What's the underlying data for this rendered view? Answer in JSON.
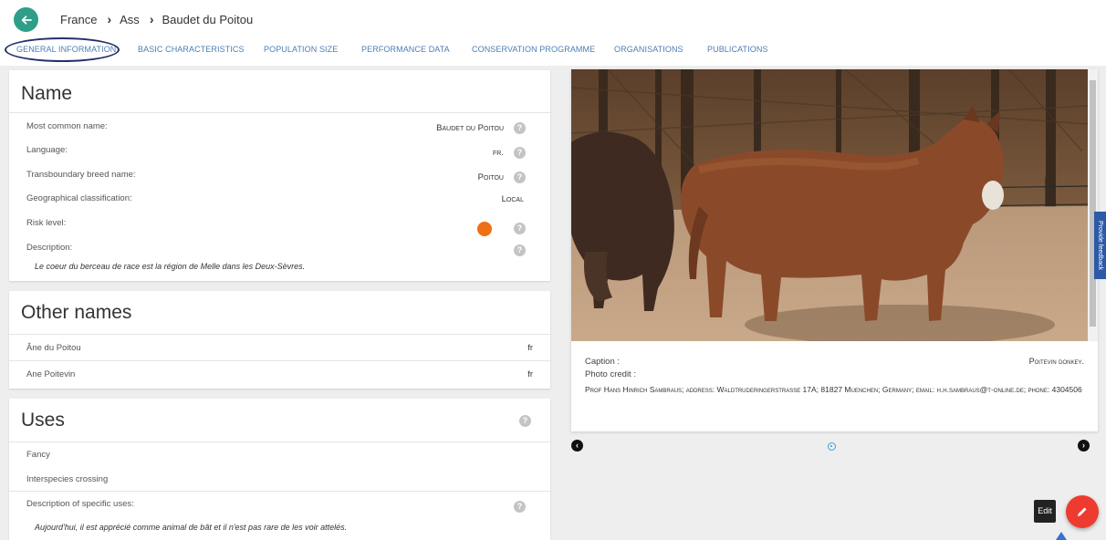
{
  "header": {
    "breadcrumb": [
      "France",
      "Ass",
      "Baudet du Poitou"
    ],
    "tabs": [
      "GENERAL INFORMATION",
      "BASIC CHARACTERISTICS",
      "POPULATION SIZE",
      "PERFORMANCE DATA",
      "CONSERVATION PROGRAMME",
      "ORGANISATIONS",
      "PUBLICATIONS"
    ]
  },
  "name_section": {
    "title": "Name",
    "rows": [
      {
        "label": "Most common name:",
        "value": "Baudet du Poitou"
      },
      {
        "label": "Language:",
        "value": "fr."
      },
      {
        "label": "Transboundary breed name:",
        "value": "Poitou"
      },
      {
        "label": "Geographical classification:",
        "value": "Local"
      },
      {
        "label": "Risk level:",
        "value": ""
      },
      {
        "label": "Description:",
        "value": ""
      }
    ],
    "description": "Le coeur du berceau de race est la région de Melle dans les Deux-Sèvres.",
    "risk_color": "#ee6f16"
  },
  "other_names": {
    "title": "Other names",
    "items": [
      {
        "name": "Âne du Poitou",
        "lang": "fr"
      },
      {
        "name": "Ane Poitevin",
        "lang": "fr"
      }
    ]
  },
  "uses": {
    "title": "Uses",
    "items": [
      "Fancy",
      "Interspecies crossing"
    ],
    "specific_label": "Description of specific uses:",
    "specific_text": "Aujourd'hui, il est apprécié comme animal de bât et il n'est pas rare de les voir attelés."
  },
  "photo": {
    "caption_label": "Caption :",
    "caption_value": "Poitevin donkey.",
    "credit_label": "Photo credit :",
    "credit_text": "Prof Hans Hinrich Sambraus; address: Waldtruderingerstrasse 17A; 81827 Muenchen; Germany; email: h.h.sambraus@t-online.de; phone: 4304506"
  },
  "feedback_label": "Provide feedback",
  "edit_label": "Edit",
  "colors": {
    "accent": "#2f9e89",
    "tab_text": "#4a7fb5",
    "fab": "#ee3b2f",
    "risk": "#ee6f16"
  }
}
